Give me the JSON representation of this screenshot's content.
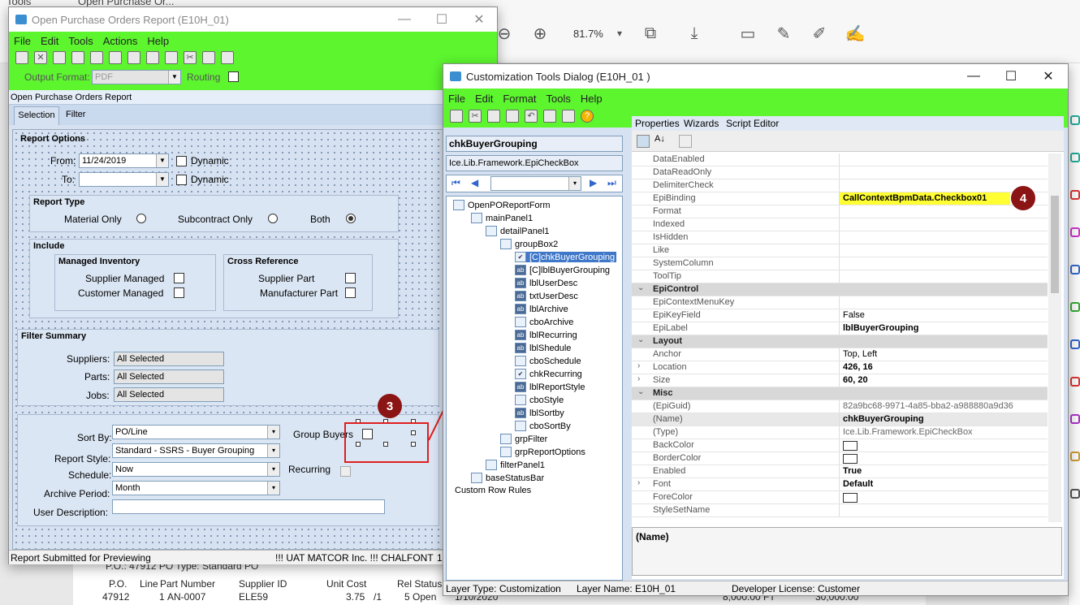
{
  "background": {
    "tabs": [
      "Tools",
      "Open Purchase Or..."
    ],
    "zoom": "81.7%",
    "pdf": {
      "row1": "P.O.: 47912     PO Type: Standard PO",
      "headers": [
        "P.O.",
        "Line",
        "Part Number",
        "Supplier ID",
        "Unit Cost",
        "Rel Status"
      ],
      "values": [
        "47912",
        "1",
        "AN-0007",
        "ELE59",
        "3.75",
        "/1",
        "5 Open",
        "1/10/2020",
        "8,000.00 FT",
        "30,000.00"
      ]
    }
  },
  "report_window": {
    "title": "Open Purchase Orders Report  (E10H_01)",
    "menu": [
      "File",
      "Edit",
      "Tools",
      "Actions",
      "Help"
    ],
    "output_format_label": "Output Format:",
    "output_format_value": "PDF",
    "routing_label": "Routing",
    "header": "Open Purchase Orders Report",
    "tabs": [
      "Selection",
      "Filter"
    ],
    "report_options": {
      "title": "Report Options",
      "from_label": "From:",
      "from_value": "11/24/2019",
      "to_label": "To:",
      "to_value": "",
      "dynamic": "Dynamic"
    },
    "report_type": {
      "title": "Report Type",
      "options": [
        "Material Only",
        "Subcontract Only",
        "Both"
      ],
      "selected": "Both"
    },
    "include": {
      "title": "Include",
      "managed_inventory": "Managed Inventory",
      "supplier_managed": "Supplier Managed",
      "customer_managed": "Customer Managed",
      "cross_reference": "Cross Reference",
      "supplier_part": "Supplier Part",
      "manufacturer_part": "Manufacturer Part"
    },
    "filter_summary": {
      "title": "Filter Summary",
      "suppliers_label": "Suppliers:",
      "suppliers_value": "All Selected",
      "parts_label": "Parts:",
      "parts_value": "All Selected",
      "jobs_label": "Jobs:",
      "jobs_value": "All Selected"
    },
    "sort_by_label": "Sort By:",
    "sort_by_value": "PO/Line",
    "report_style_label": "Report Style:",
    "report_style_value": "Standard - SSRS - Buyer Grouping",
    "schedule_label": "Schedule:",
    "schedule_value": "Now",
    "archive_label": "Archive Period:",
    "archive_value": "Month",
    "user_desc_label": "User Description:",
    "group_buyers_label": "Group Buyers",
    "recurring_label": "Recurring",
    "status_left": "Report Submitted for Previewing",
    "status_mid": "!!! UAT MATCOR Inc. !!!",
    "status_right": "CHALFONT",
    "status_num": "1"
  },
  "dialog": {
    "title": "Customization Tools Dialog  (E10H_01 )",
    "menu": [
      "File",
      "Edit",
      "Format",
      "Tools",
      "Help"
    ],
    "selected_control": "chkBuyerGrouping",
    "selected_type": "Ice.Lib.Framework.EpiCheckBox",
    "tabs": [
      "Properties",
      "Wizards",
      "Script Editor"
    ],
    "tree": [
      "OpenPOReportForm",
      "mainPanel1",
      "detailPanel1",
      "groupBox2",
      "[C]chkBuyerGrouping",
      "[C]lblBuyerGrouping",
      "lblUserDesc",
      "txtUserDesc",
      "lblArchive",
      "cboArchive",
      "lblRecurring",
      "lblShedule",
      "cboSchedule",
      "chkRecurring",
      "lblReportStyle",
      "cboStyle",
      "lblSortby",
      "cboSortBy",
      "grpFilter",
      "grpReportOptions",
      "filterPanel1",
      "baseStatusBar",
      "Custom Row Rules"
    ],
    "properties": [
      {
        "name": "DataEnabled",
        "value": ""
      },
      {
        "name": "DataReadOnly",
        "value": ""
      },
      {
        "name": "DelimiterCheck",
        "value": ""
      },
      {
        "name": "EpiBinding",
        "value": "CallContextBpmData.Checkbox01"
      },
      {
        "name": "Format",
        "value": ""
      },
      {
        "name": "Indexed",
        "value": ""
      },
      {
        "name": "IsHidden",
        "value": ""
      },
      {
        "name": "Like",
        "value": ""
      },
      {
        "name": "SystemColumn",
        "value": ""
      },
      {
        "name": "ToolTip",
        "value": ""
      },
      {
        "cat": "EpiControl"
      },
      {
        "name": "EpiContextMenuKey",
        "value": ""
      },
      {
        "name": "EpiKeyField",
        "value": "False"
      },
      {
        "name": "EpiLabel",
        "value": "lblBuyerGrouping"
      },
      {
        "cat": "Layout"
      },
      {
        "name": "Anchor",
        "value": "Top, Left"
      },
      {
        "name": "Location",
        "value": "426, 16"
      },
      {
        "name": "Size",
        "value": "60, 20"
      },
      {
        "cat": "Misc"
      },
      {
        "name": "(EpiGuid)",
        "value": "82a9bc68-9971-4a85-bba2-a988880a9d36"
      },
      {
        "name": "(Name)",
        "value": "chkBuyerGrouping"
      },
      {
        "name": "(Type)",
        "value": "Ice.Lib.Framework.EpiCheckBox"
      },
      {
        "name": "BackColor",
        "value": ""
      },
      {
        "name": "BorderColor",
        "value": ""
      },
      {
        "name": "Enabled",
        "value": "True"
      },
      {
        "name": "Font",
        "value": "Default"
      },
      {
        "name": "ForeColor",
        "value": ""
      },
      {
        "name": "StyleSetName",
        "value": ""
      }
    ],
    "desc_title": "(Name)",
    "status": {
      "layer_type": "Layer Type:  Customization",
      "layer_name": "Layer Name:  E10H_01",
      "license": "Developer License:  Customer"
    }
  },
  "markers": {
    "m3": "3",
    "m4": "4"
  },
  "colors": {
    "toolbar_green": "#5cf52e",
    "highlight_yellow": "#ffff33",
    "annotation_red": "#e01e1e"
  }
}
